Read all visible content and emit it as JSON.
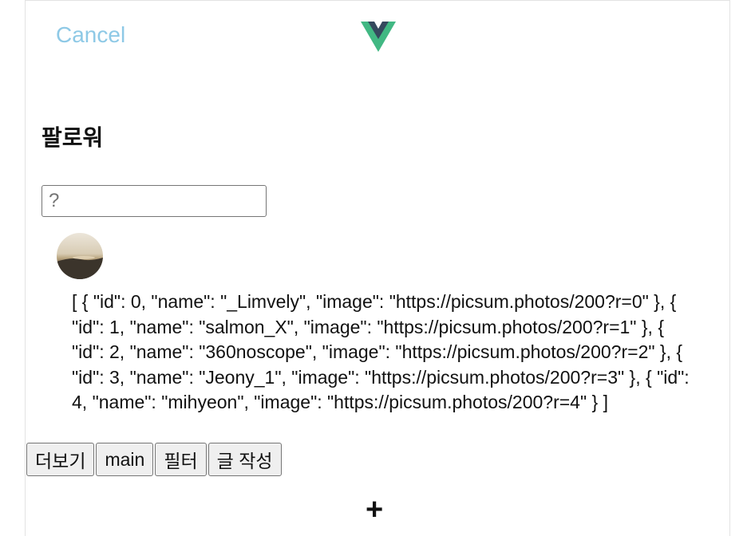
{
  "header": {
    "cancel_label": "Cancel",
    "logo_icon": "vue-logo-icon",
    "logo_colors": {
      "outer": "#41b883",
      "inner": "#35495e"
    }
  },
  "main": {
    "title": "팔로워",
    "search": {
      "placeholder": "?",
      "value": ""
    },
    "avatar_icon": "user-avatar-photo",
    "json_text": "[ { \"id\": 0, \"name\": \"_Limvely\", \"image\": \"https://picsum.photos/200?r=0\" }, { \"id\": 1, \"name\": \"salmon_X\", \"image\": \"https://picsum.photos/200?r=1\" }, { \"id\": 2, \"name\": \"360noscope\", \"image\": \"https://picsum.photos/200?r=2\" }, { \"id\": 3, \"name\": \"Jeony_1\", \"image\": \"https://picsum.photos/200?r=3\" }, { \"id\": 4, \"name\": \"mihyeon\", \"image\": \"https://picsum.photos/200?r=4\" } ]"
  },
  "buttons": {
    "more": "더보기",
    "main": "main",
    "filter": "필터",
    "write": "글 작성"
  },
  "footer": {
    "plus_label": "+"
  },
  "colors": {
    "cancel": "#8ec9e6",
    "border": "#e3e3e3"
  }
}
